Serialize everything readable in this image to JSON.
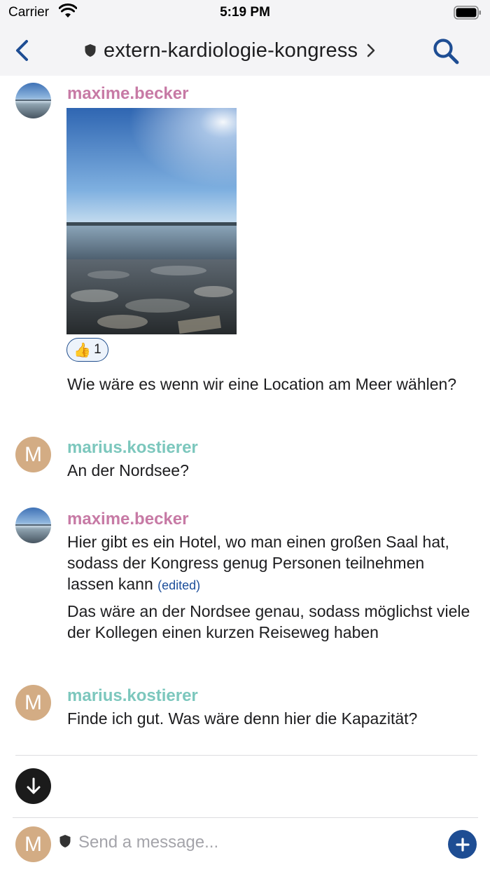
{
  "status_bar": {
    "carrier": "Carrier",
    "time": "5:19 PM",
    "icons": [
      "wifi-icon",
      "battery-icon"
    ]
  },
  "header": {
    "title": "extern-kardiologie-kongress",
    "icons": [
      "back-chevron-icon",
      "shield-icon",
      "chevron-right-icon",
      "search-icon"
    ]
  },
  "messages": [
    {
      "user": "maxime.becker",
      "avatar": "photo",
      "has_image": true,
      "reaction": {
        "emoji": "👍",
        "count": "1"
      },
      "text": "Wie wäre es wenn wir eine Location am Meer wählen?"
    },
    {
      "user": "marius.kostierer",
      "avatar_letter": "M",
      "text": "An der Nordsee?"
    },
    {
      "user": "maxime.becker",
      "avatar": "photo",
      "text": "Hier gibt es ein Hotel, wo man einen großen Saal hat, sodass der Kongress genug Personen teilnehmen lassen kann",
      "edited_label": "(edited)",
      "text2": "Das wäre an der Nordsee genau, sodass möglichst viele der Kollegen einen kurzen Reiseweg haben"
    },
    {
      "user": "marius.kostierer",
      "avatar_letter": "M",
      "text": "Finde ich gut. Was wäre denn hier die Kapazität?"
    }
  ],
  "composer": {
    "avatar_letter": "M",
    "placeholder": "Send a message...",
    "icons": [
      "shield-icon",
      "plus-icon",
      "arrow-down-icon"
    ]
  },
  "colors": {
    "user_pink": "#c77aa5",
    "user_teal": "#7cc7bd",
    "accent_blue": "#1e4d93",
    "bar_background": "#f4f4f6"
  }
}
